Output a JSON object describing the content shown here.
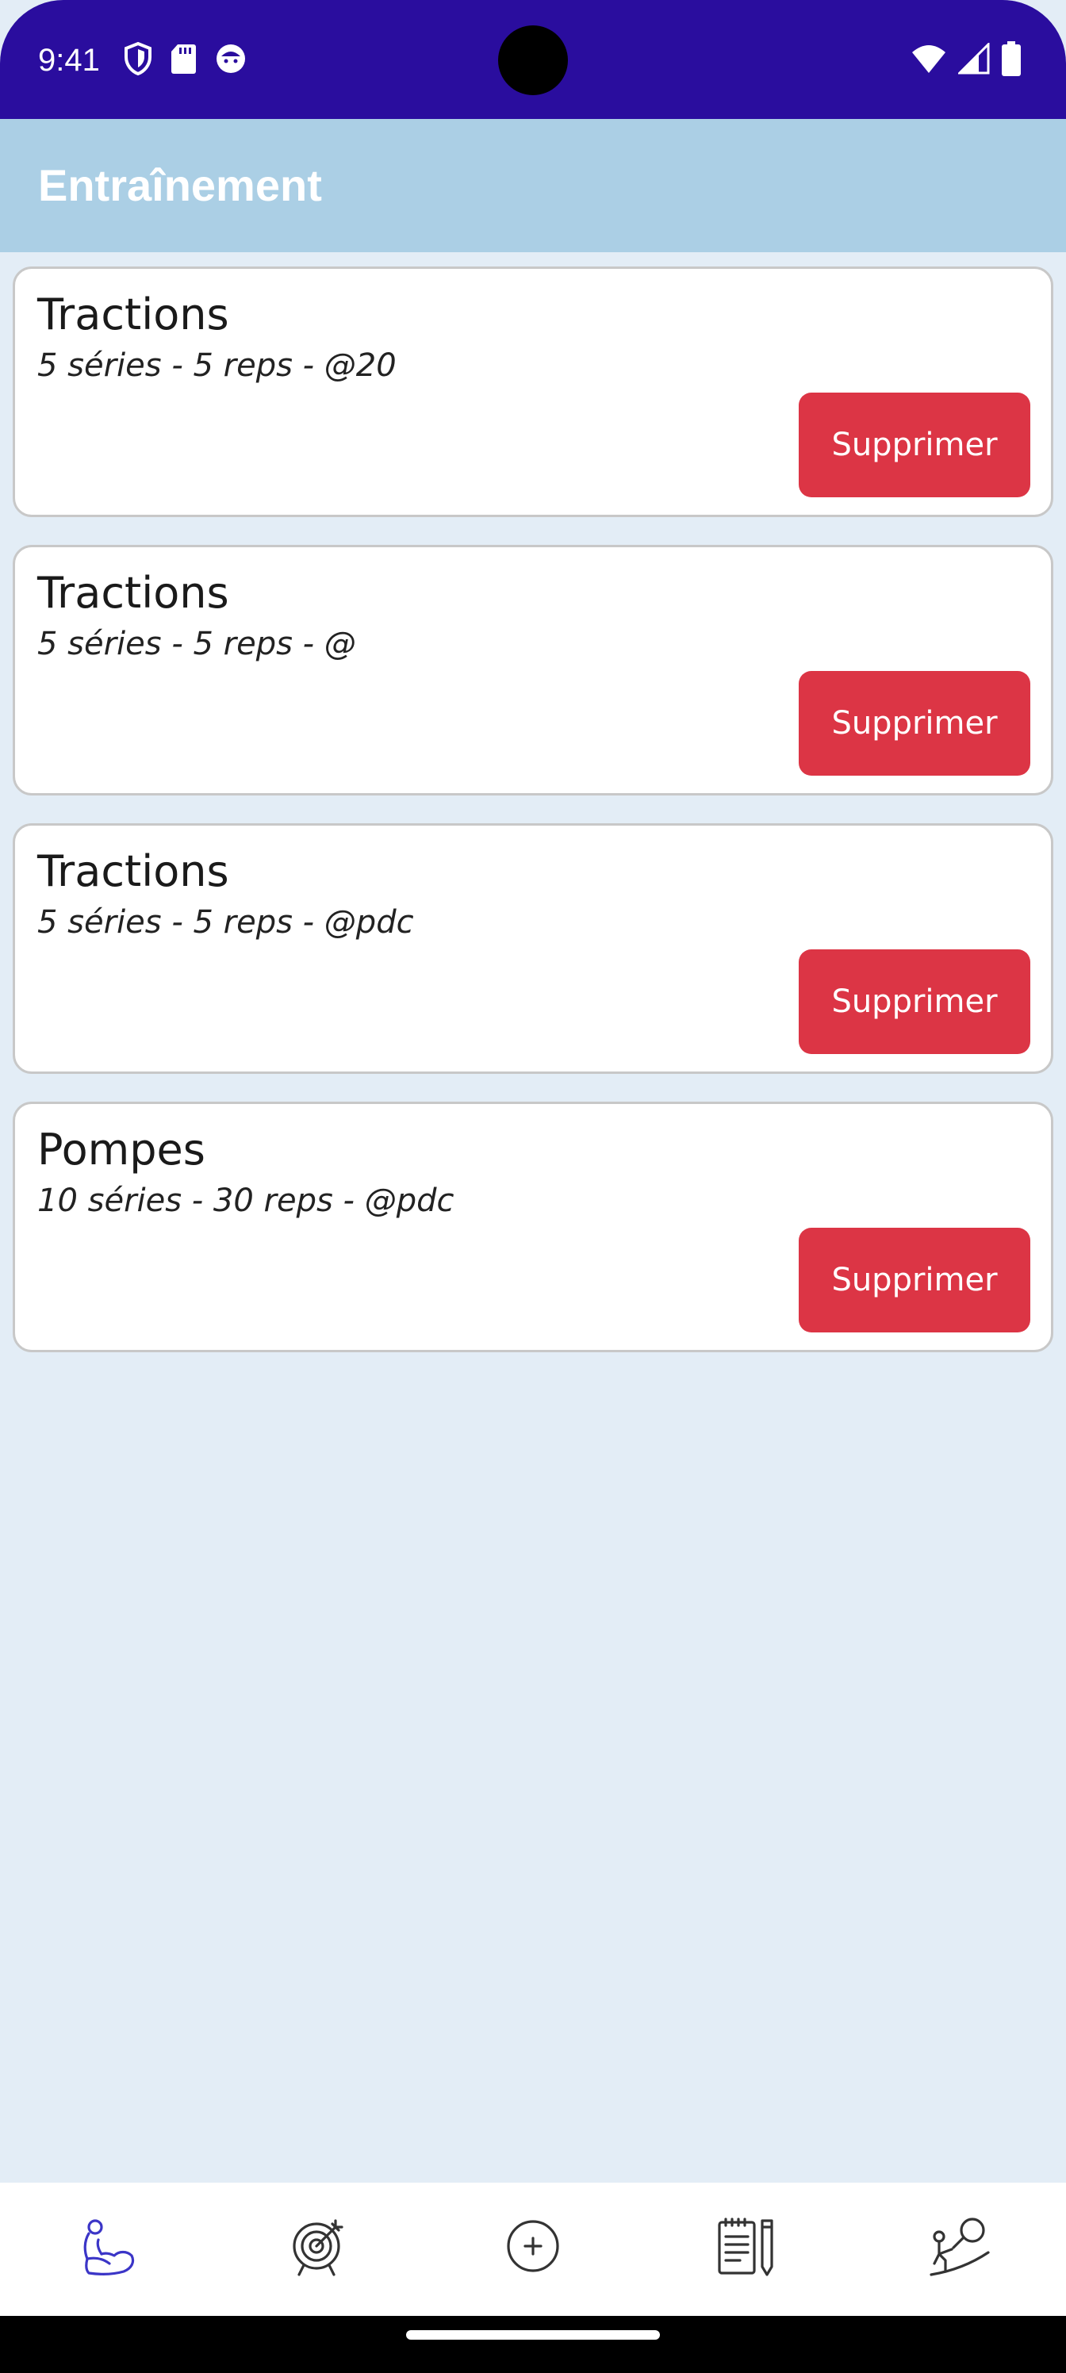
{
  "status_bar": {
    "time": "9:41",
    "left_icons": [
      "shield-icon",
      "sd-card-icon",
      "face-icon"
    ],
    "right_icons": [
      "wifi-icon",
      "signal-icon",
      "battery-icon"
    ],
    "background_color": "#2a0d9e"
  },
  "app_bar": {
    "title": "Entraînement",
    "background_color": "#abcfe5"
  },
  "exercises": [
    {
      "name": "Tractions",
      "detail": "5 séries - 5 reps - @20",
      "delete_label": "Supprimer"
    },
    {
      "name": "Tractions",
      "detail": "5 séries - 5 reps - @",
      "delete_label": "Supprimer"
    },
    {
      "name": "Tractions",
      "detail": "5 séries - 5 reps - @pdc",
      "delete_label": "Supprimer"
    },
    {
      "name": "Pompes",
      "detail": "10 séries - 30 reps - @pdc",
      "delete_label": "Supprimer"
    }
  ],
  "colors": {
    "page_background": "#e3edf6",
    "delete_button": "#dc3545",
    "active_nav_icon": "#3b35c7",
    "inactive_nav_icon": "#333333"
  },
  "bottom_nav": {
    "items": [
      {
        "icon": "muscle-arm-icon",
        "active": true
      },
      {
        "icon": "target-icon",
        "active": false
      },
      {
        "icon": "add-circle-icon",
        "active": false
      },
      {
        "icon": "notepad-pencil-icon",
        "active": false
      },
      {
        "icon": "training-goal-icon",
        "active": false
      }
    ]
  }
}
